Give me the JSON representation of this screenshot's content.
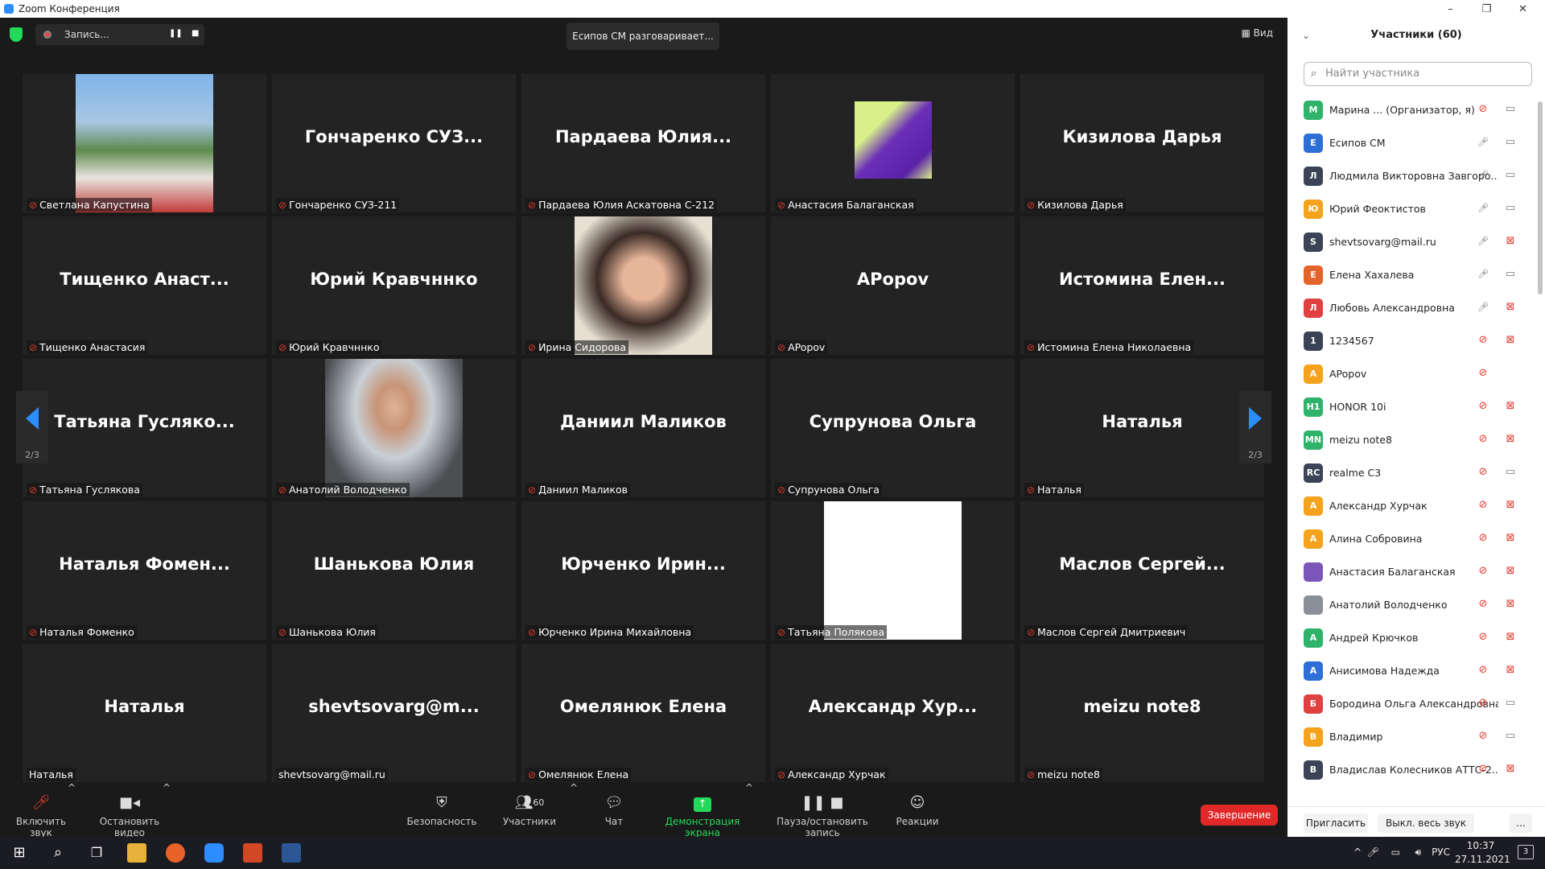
{
  "window": {
    "title": "Zoom Конференция",
    "min": "–",
    "restore": "❐",
    "close": "✕"
  },
  "top": {
    "record_label": "Запись...",
    "speaking": "Есипов СМ разговаривает...",
    "view_label": "Вид"
  },
  "pager": {
    "left": "2/3",
    "right": "2/3"
  },
  "tiles": [
    {
      "big": "",
      "label": "Светлана Капустина",
      "muted": true,
      "photo": "woman-outdoor"
    },
    {
      "big": "Гончаренко  СУЗ...",
      "label": "Гончаренко СУЗ-211",
      "muted": true
    },
    {
      "big": "Пардаева  Юлия...",
      "label": "Пардаева Юлия Аскатовна С-212",
      "muted": true
    },
    {
      "big": "",
      "label": "Анастасия Балаганская",
      "muted": true,
      "photo": "avatar-purple"
    },
    {
      "big": "Кизилова Дарья",
      "label": "Кизилова Дарья",
      "muted": true
    },
    {
      "big": "Тищенко  Анаст...",
      "label": "Тищенко Анастасия",
      "muted": true
    },
    {
      "big": "Юрий Кравчннко",
      "label": "Юрий Кравчннко",
      "muted": true
    },
    {
      "big": "",
      "label": "Ирина Сидорова",
      "muted": true,
      "photo": "woman-portrait"
    },
    {
      "big": "APopov",
      "label": "APopov",
      "muted": true
    },
    {
      "big": "Истомина  Елен...",
      "label": "Истомина Елена Николаевна",
      "muted": true
    },
    {
      "big": "Татьяна  Гусляко...",
      "label": "Татьяна Гуслякова",
      "muted": true
    },
    {
      "big": "",
      "label": "Анатолий Володченко",
      "muted": true,
      "photo": "man-portrait"
    },
    {
      "big": "Даниил Маликов",
      "label": "Даниил Маликов",
      "muted": true
    },
    {
      "big": "Супрунова Ольга",
      "label": "Супрунова Ольга",
      "muted": true
    },
    {
      "big": "Наталья",
      "label": "Наталья",
      "muted": true
    },
    {
      "big": "Наталья  Фомен...",
      "label": "Наталья Фоменко",
      "muted": true
    },
    {
      "big": "Шанькова Юлия",
      "label": "Шанькова Юлия",
      "muted": true
    },
    {
      "big": "Юрченко  Ирин...",
      "label": "Юрченко Ирина Михайловна",
      "muted": true
    },
    {
      "big": "",
      "label": "Татьяна Полякова",
      "muted": true,
      "photo": "white"
    },
    {
      "big": "Маслов  Сергей...",
      "label": "Маслов Сергей Дмитриевич",
      "muted": true
    },
    {
      "big": "Наталья",
      "label": "Наталья",
      "muted": false
    },
    {
      "big": "shevtsovarg@m...",
      "label": "shevtsovarg@mail.ru",
      "muted": false
    },
    {
      "big": "Омелянюк Елена",
      "label": "Омелянюк Елена",
      "muted": true
    },
    {
      "big": "Александр  Хур...",
      "label": "Александр Хурчак",
      "muted": true
    },
    {
      "big": "meizu note8",
      "label": "meizu note8",
      "muted": true
    }
  ],
  "toolbar": {
    "unmute": "Включить звук",
    "stop_video": "Остановить видео",
    "security": "Безопасность",
    "participants": "Участники",
    "participants_count": "60",
    "chat": "Чат",
    "share": "Демонстрация экрана",
    "pause_record": "Пауза/остановить запись",
    "reactions": "Реакции",
    "end": "Завершение"
  },
  "panel": {
    "title": "Участники (60)",
    "search_placeholder": "Найти участника",
    "invite": "Пригласить",
    "mute_all": "Выкл. весь звук",
    "more": "...",
    "participants": [
      {
        "initials": "М",
        "color": "#2fb36b",
        "name": "Марина ... (Организатор, я)",
        "mic": "muted",
        "cam": "on"
      },
      {
        "initials": "Е",
        "color": "#2d6fd6",
        "name": "Есипов СМ",
        "mic": "on",
        "cam": "on"
      },
      {
        "initials": "Л",
        "color": "#3a4456",
        "name": "Людмила Викторовна Завгоро...",
        "mic": "on",
        "cam": "on"
      },
      {
        "initials": "Ю",
        "color": "#f5a21c",
        "name": "Юрий Феоктистов",
        "mic": "on",
        "cam": "on"
      },
      {
        "initials": "S",
        "color": "#3a4456",
        "name": "shevtsovarg@mail.ru",
        "mic": "on",
        "cam": "off"
      },
      {
        "initials": "Е",
        "color": "#e3632c",
        "name": "Елена Хахалева",
        "mic": "on",
        "cam": "on"
      },
      {
        "initials": "Л",
        "color": "#e04040",
        "name": "Любовь Александровна",
        "mic": "on",
        "cam": "off"
      },
      {
        "initials": "1",
        "color": "#3a4456",
        "name": "1234567",
        "mic": "muted",
        "cam": "off"
      },
      {
        "initials": "A",
        "color": "#f5a21c",
        "name": "APopov",
        "mic": "muted",
        "cam": "none"
      },
      {
        "initials": "H1",
        "color": "#2fb36b",
        "name": "HONOR 10i",
        "mic": "muted",
        "cam": "off"
      },
      {
        "initials": "MN",
        "color": "#2fb36b",
        "name": "meizu note8",
        "mic": "muted",
        "cam": "off"
      },
      {
        "initials": "RC",
        "color": "#3a4456",
        "name": "realme C3",
        "mic": "muted",
        "cam": "on"
      },
      {
        "initials": "А",
        "color": "#f5a21c",
        "name": "Александр Хурчак",
        "mic": "muted",
        "cam": "off"
      },
      {
        "initials": "А",
        "color": "#f5a21c",
        "name": "Алина Собровина",
        "mic": "muted",
        "cam": "off"
      },
      {
        "initials": "",
        "color": "#7a56b8",
        "name": "Анастасия Балаганская",
        "mic": "muted",
        "cam": "off"
      },
      {
        "initials": "",
        "color": "#8a8f99",
        "name": "Анатолий Володченко",
        "mic": "muted",
        "cam": "off"
      },
      {
        "initials": "А",
        "color": "#2fb36b",
        "name": "Андрей Крючков",
        "mic": "muted",
        "cam": "off"
      },
      {
        "initials": "А",
        "color": "#2d6fd6",
        "name": "Анисимова Надежда",
        "mic": "muted",
        "cam": "off"
      },
      {
        "initials": "Б",
        "color": "#e04040",
        "name": "Бородина Ольга Александровна",
        "mic": "muted",
        "cam": "on"
      },
      {
        "initials": "В",
        "color": "#f5a21c",
        "name": "Владимир",
        "mic": "muted",
        "cam": "on"
      },
      {
        "initials": "В",
        "color": "#3a4456",
        "name": "Владислав Колесников АТТС-2...",
        "mic": "muted",
        "cam": "off"
      }
    ]
  },
  "taskbar": {
    "lang": "РУС",
    "time": "10:37",
    "date": "27.11.2021",
    "notif": "3"
  }
}
